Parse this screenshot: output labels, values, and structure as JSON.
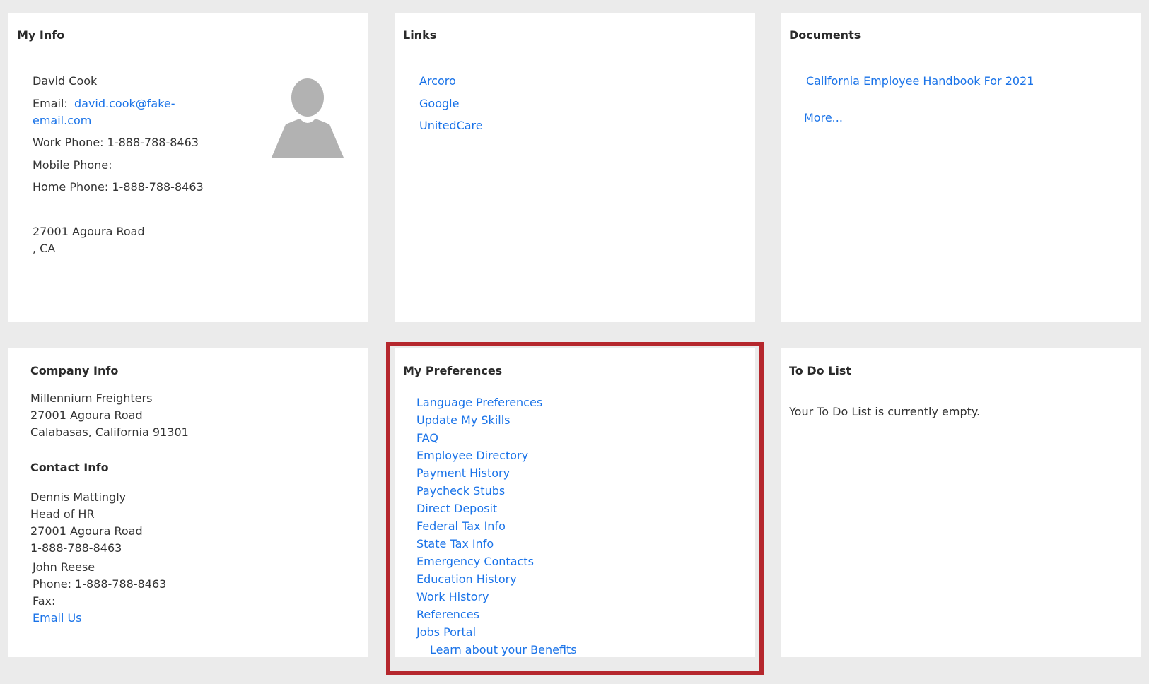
{
  "my_info": {
    "title": "My Info",
    "name": "David Cook",
    "email_label": "Email:",
    "email_line1": "david.cook@fake-",
    "email_line2": "email.com",
    "work_phone": "Work Phone:  1-888-788-8463",
    "mobile_phone": "Mobile Phone:",
    "home_phone": "Home Phone:  1-888-788-8463",
    "address_line1": "27001 Agoura Road",
    "address_line2": ", CA"
  },
  "links": {
    "title": "Links",
    "items": [
      "Arcoro",
      "Google",
      "UnitedCare"
    ]
  },
  "documents": {
    "title": "Documents",
    "items": [
      "California Employee Handbook For 2021"
    ],
    "more_label": "More..."
  },
  "company_info": {
    "title": "Company Info",
    "lines": [
      "Millennium Freighters",
      "27001 Agoura Road",
      "Calabasas, California 91301"
    ]
  },
  "contact_info": {
    "title": "Contact Info",
    "lines": [
      "Dennis Mattingly",
      "Head of HR",
      "27001 Agoura Road",
      "1-888-788-8463"
    ],
    "secondary": [
      "John Reese",
      "Phone: 1-888-788-8463",
      "Fax:"
    ],
    "email_us": "Email Us"
  },
  "my_preferences": {
    "title": "My Preferences",
    "items": [
      "Language Preferences",
      "Update My Skills",
      "FAQ",
      "Employee Directory",
      "Payment History",
      "Paycheck Stubs",
      "Direct Deposit",
      "Federal Tax Info",
      "State Tax Info",
      "Emergency Contacts",
      "Education History",
      "Work History",
      "References",
      "Jobs Portal"
    ],
    "benefits_link": "Learn about your Benefits"
  },
  "todo": {
    "title": "To Do List",
    "empty_text": "Your To Do List is currently empty."
  },
  "colors": {
    "background": "#ebebeb",
    "panel": "#ffffff",
    "link": "#1a73e8",
    "highlight": "#b5272d",
    "avatar": "#b2b2b2"
  }
}
